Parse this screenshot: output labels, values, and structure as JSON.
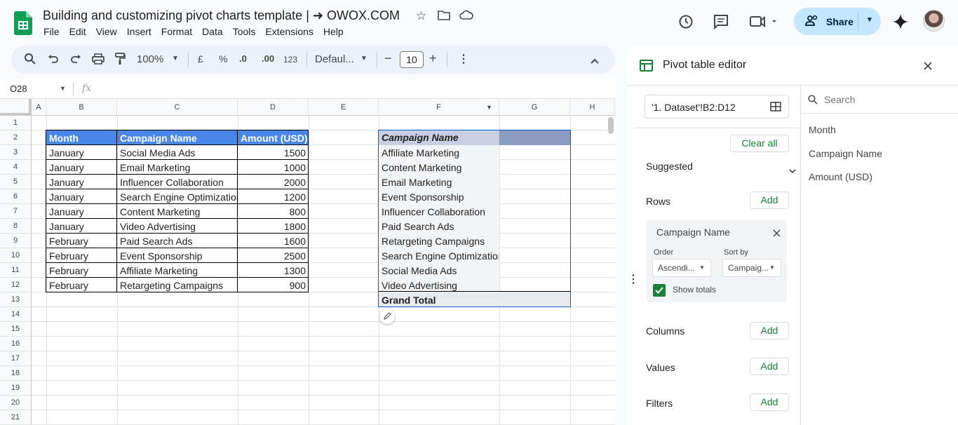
{
  "header": {
    "title": "Building and customizing pivot charts template | ➜ OWOX.COM",
    "menu": [
      "File",
      "Edit",
      "View",
      "Insert",
      "Format",
      "Data",
      "Tools",
      "Extensions",
      "Help"
    ],
    "share_label": "Share"
  },
  "toolbar": {
    "zoom": "100%",
    "currency": "£",
    "percent": "%",
    "dec_less": ".0",
    "dec_more": ".00",
    "number_format": "123",
    "font": "Defaul...",
    "font_size": "10"
  },
  "formula_bar": {
    "cell_ref": "O28",
    "fx": "fx"
  },
  "grid": {
    "columns": [
      "A",
      "B",
      "C",
      "D",
      "E",
      "F",
      "G",
      "H"
    ],
    "rows": [
      "1",
      "2",
      "3",
      "4",
      "5",
      "6",
      "7",
      "8",
      "9",
      "10",
      "11",
      "12",
      "13",
      "14",
      "15",
      "16",
      "17",
      "18",
      "19",
      "20",
      "21"
    ],
    "dataset": {
      "headers": [
        "Month",
        "Campaign Name",
        "Amount (USD)"
      ],
      "rows": [
        [
          "January",
          "Social Media Ads",
          "1500"
        ],
        [
          "January",
          "Email Marketing",
          "1000"
        ],
        [
          "January",
          "Influencer Collaboration",
          "2000"
        ],
        [
          "January",
          "Search Engine Optimization",
          "1200"
        ],
        [
          "January",
          "Content Marketing",
          "800"
        ],
        [
          "January",
          "Video Advertising",
          "1800"
        ],
        [
          "February",
          "Paid Search Ads",
          "1600"
        ],
        [
          "February",
          "Event Sponsorship",
          "2500"
        ],
        [
          "February",
          "Affiliate Marketing",
          "1300"
        ],
        [
          "February",
          "Retargeting Campaigns",
          "900"
        ]
      ]
    },
    "pivot": {
      "header": "Campaign Name",
      "items": [
        "Affiliate Marketing",
        "Content Marketing",
        "Email Marketing",
        "Event Sponsorship",
        "Influencer Collaboration",
        "Paid Search Ads",
        "Retargeting Campaigns",
        "Search Engine Optimization",
        "Social Media Ads",
        "Video Advertising"
      ],
      "total": "Grand Total"
    }
  },
  "pivot_editor": {
    "title": "Pivot table editor",
    "range": "'1. Dataset'!B2:D12",
    "clear_all": "Clear all",
    "suggested": "Suggested",
    "rows_label": "Rows",
    "add_label": "Add",
    "row_field": {
      "name": "Campaign Name",
      "order_label": "Order",
      "order_value": "Ascendi...",
      "sort_label": "Sort by",
      "sort_value": "Campaig...",
      "show_totals": "Show totals"
    },
    "columns_label": "Columns",
    "values_label": "Values",
    "filters_label": "Filters",
    "search_placeholder": "Search",
    "fields": [
      "Month",
      "Campaign Name",
      "Amount (USD)"
    ]
  },
  "colors": {
    "accent": "#0b57d0",
    "header_fill": "#4a86e8",
    "pivot_header": "#c9cfe3",
    "sheets_green": "#188038"
  }
}
